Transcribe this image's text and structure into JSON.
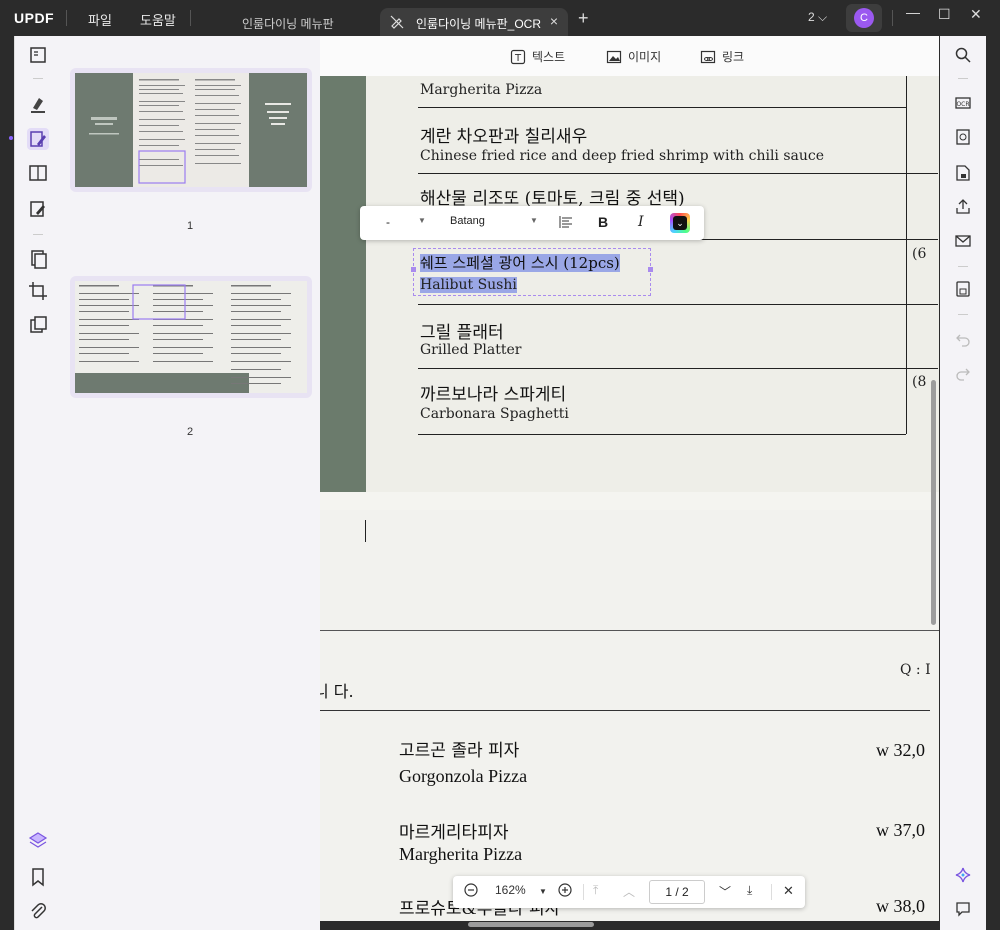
{
  "app": {
    "logo": "UPDF",
    "menu": [
      "파일",
      "도움말"
    ],
    "tabs": [
      {
        "label": "인룸다이닝 메뉴판",
        "active": false
      },
      {
        "label": "인룸다이닝 메뉴판_OCR",
        "active": true
      }
    ],
    "plus": "+",
    "tab_close": "×",
    "page_count": "2",
    "user_initial": "C",
    "accent": "#9b59f0"
  },
  "edit_toolbar": {
    "text_label": "텍스트",
    "image_label": "이미지",
    "link_label": "링크"
  },
  "font_toolbar": {
    "size": "-",
    "font": "Batang",
    "bold": "B",
    "italic": "I"
  },
  "thumbnails": [
    {
      "label": "1"
    },
    {
      "label": "2"
    }
  ],
  "page1": {
    "items": [
      {
        "en": "Margherita Pizza"
      },
      {
        "ko": "계란 차오판과 칠리새우",
        "en": "Chinese fried rice and deep fried shrimp with chili sauce"
      },
      {
        "ko": "해산물 리조또 (토마토, 크림 중 선택)"
      },
      {
        "ko": "쉐프 스페셜 광어 스시 (12pcs)",
        "en": "Halibut Sushi",
        "price_cut": "(6"
      },
      {
        "ko": "그릴 플래터",
        "en": "Grilled Platter"
      },
      {
        "ko": "까르보나라 스파게티",
        "en": "Carbonara Spaghetti",
        "price_cut": "(8"
      }
    ]
  },
  "page2": {
    "note_right": "Q : I",
    "note_left": "니 다.",
    "items": [
      {
        "ko": "고르곤 졸라 피자",
        "en": "Gorgonzola Pizza",
        "price": "w 32,0"
      },
      {
        "ko": "마르게리타피자",
        "en": "Margherita Pizza",
        "price": "w 37,0"
      },
      {
        "ko": "프로슈토&루꼴라 피자",
        "price": "w 38,0"
      }
    ]
  },
  "nav": {
    "zoom": "162%",
    "page_display": "1 / 2"
  }
}
